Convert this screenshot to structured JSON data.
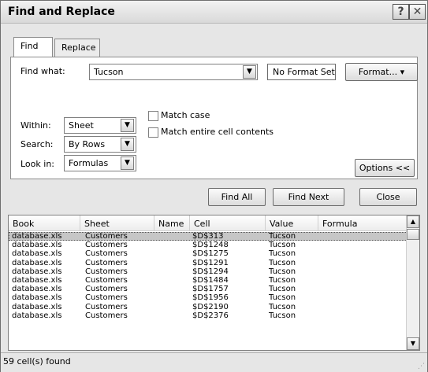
{
  "window": {
    "title": "Find and Replace",
    "help_glyph": "?",
    "close_glyph": "✕"
  },
  "tabs": [
    {
      "label": "Find"
    },
    {
      "label": "Replace"
    }
  ],
  "find": {
    "label": "Find what:",
    "value": "Tucson",
    "no_format_label": "No Format Set",
    "format_button": "Format...",
    "within_label": "Within:",
    "within_value": "Sheet",
    "search_label": "Search:",
    "search_value": "By Rows",
    "lookin_label": "Look in:",
    "lookin_value": "Formulas",
    "match_case_label": "Match case",
    "match_case_checked": false,
    "match_entire_label": "Match entire cell contents",
    "match_entire_checked": false,
    "options_button": "Options <<"
  },
  "actions": {
    "find_all": "Find All",
    "find_next": "Find Next",
    "close": "Close"
  },
  "results": {
    "columns": [
      "Book",
      "Sheet",
      "Name",
      "Cell",
      "Value",
      "Formula"
    ],
    "rows": [
      [
        "database.xls",
        "Customers",
        "",
        "$D$313",
        "Tucson",
        ""
      ],
      [
        "database.xls",
        "Customers",
        "",
        "$D$1248",
        "Tucson",
        ""
      ],
      [
        "database.xls",
        "Customers",
        "",
        "$D$1275",
        "Tucson",
        ""
      ],
      [
        "database.xls",
        "Customers",
        "",
        "$D$1291",
        "Tucson",
        ""
      ],
      [
        "database.xls",
        "Customers",
        "",
        "$D$1294",
        "Tucson",
        ""
      ],
      [
        "database.xls",
        "Customers",
        "",
        "$D$1484",
        "Tucson",
        ""
      ],
      [
        "database.xls",
        "Customers",
        "",
        "$D$1757",
        "Tucson",
        ""
      ],
      [
        "database.xls",
        "Customers",
        "",
        "$D$1956",
        "Tucson",
        ""
      ],
      [
        "database.xls",
        "Customers",
        "",
        "$D$2190",
        "Tucson",
        ""
      ],
      [
        "database.xls",
        "Customers",
        "",
        "$D$2376",
        "Tucson",
        ""
      ]
    ],
    "selected_index": 0
  },
  "status": {
    "text": "59 cell(s) found"
  },
  "colors": {
    "selected_row": "#c6c6c6",
    "dialog_bg": "#e6e6e6"
  }
}
